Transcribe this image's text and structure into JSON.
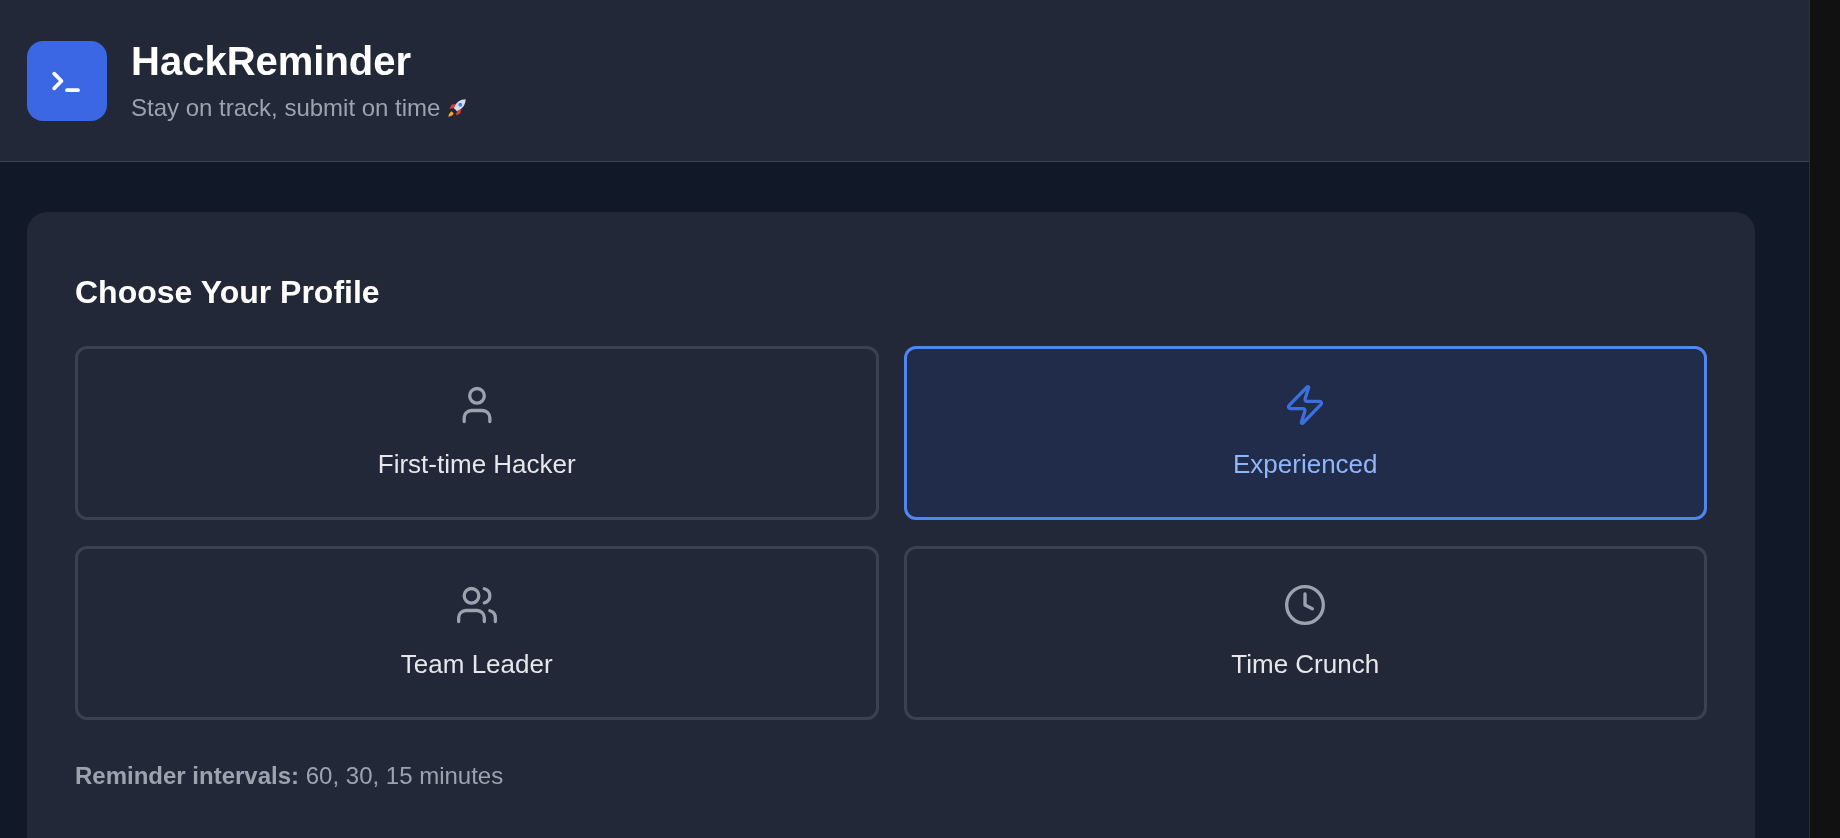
{
  "header": {
    "title": "HackReminder",
    "subtitle": "Stay on track, submit on time"
  },
  "profile_card": {
    "title": "Choose Your Profile",
    "profiles": [
      {
        "label": "First-time Hacker",
        "kind": "user",
        "selected": false
      },
      {
        "label": "Experienced",
        "kind": "bolt",
        "selected": true
      },
      {
        "label": "Team Leader",
        "kind": "users",
        "selected": false
      },
      {
        "label": "Time Crunch",
        "kind": "clock",
        "selected": false
      }
    ],
    "note": "**Reminder intervals:** 60, 30, 15 minutes"
  }
}
